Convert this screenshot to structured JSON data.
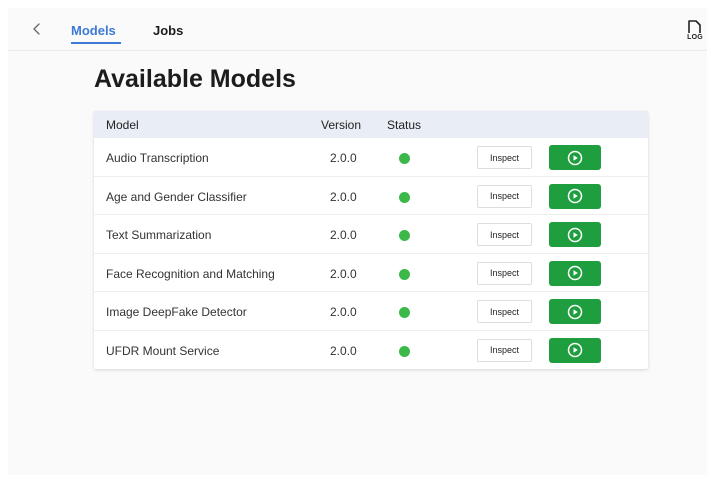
{
  "nav": {
    "back_icon": "chevron-left-icon",
    "tabs": [
      {
        "label": "Models",
        "active": true
      },
      {
        "label": "Jobs",
        "active": false
      }
    ],
    "log_label": "LOG",
    "log_icon": "log-file-icon"
  },
  "page": {
    "title": "Available Models"
  },
  "table": {
    "columns": {
      "model": "Model",
      "version": "Version",
      "status": "Status"
    },
    "inspect_label": "Inspect",
    "run_icon": "play-circle-icon",
    "rows": [
      {
        "model": "Audio Transcription",
        "version": "2.0.0",
        "status": "online"
      },
      {
        "model": "Age and Gender Classifier",
        "version": "2.0.0",
        "status": "online"
      },
      {
        "model": "Text Summarization",
        "version": "2.0.0",
        "status": "online"
      },
      {
        "model": "Face Recognition and Matching",
        "version": "2.0.0",
        "status": "online"
      },
      {
        "model": "Image DeepFake Detector",
        "version": "2.0.0",
        "status": "online"
      },
      {
        "model": "UFDR Mount Service",
        "version": "2.0.0",
        "status": "online"
      }
    ]
  },
  "colors": {
    "accent": "#3d7ad6",
    "status_online": "#3cb84a",
    "run_button": "#1e9e3e",
    "header_bg": "#e9eef6"
  }
}
